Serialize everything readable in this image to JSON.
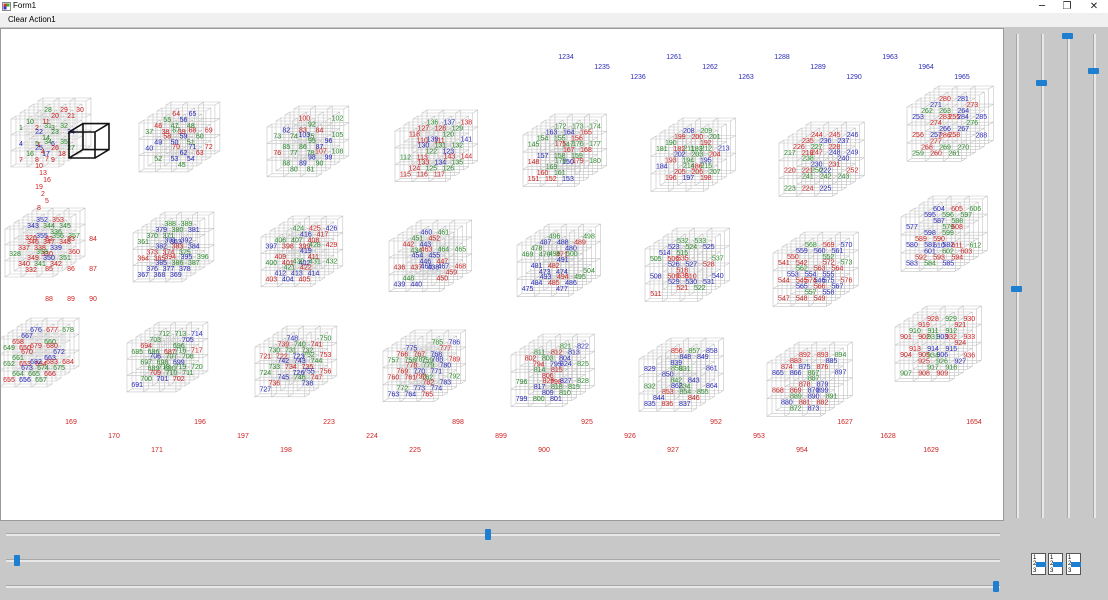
{
  "window": {
    "title": "Form1",
    "minimize": "─",
    "maximize": "❐",
    "close": "✕"
  },
  "menu": [
    "Clear",
    "Action1"
  ],
  "viewport": {
    "label_colors": [
      "#cc2222",
      "#2e8b2e",
      "#2a2ab8"
    ],
    "line_color": "#c4c4c4",
    "highlight_color": "#111111",
    "labels_left": [
      "1",
      "4",
      "7",
      "10",
      "13",
      "16",
      "19",
      "2",
      "5",
      "8"
    ],
    "labels_row2": [
      "82",
      "83",
      "84",
      "85",
      "86",
      "87",
      "88",
      "89",
      "90"
    ],
    "labels_bottom": [
      "169",
      "170",
      "171",
      "196",
      "197",
      "198",
      "223",
      "224",
      "225",
      "898",
      "899",
      "900",
      "925",
      "926",
      "927",
      "952",
      "953",
      "954",
      "1627",
      "1628",
      "1629",
      "1654"
    ],
    "labels_top": [
      "1234",
      "1235",
      "1236",
      "1261",
      "1262",
      "1263",
      "1288",
      "1289",
      "1290",
      "1963",
      "1964",
      "1965"
    ]
  },
  "sliders": {
    "right_vertical": [
      0.51,
      0.11,
      0.01,
      0.08
    ],
    "bottom_horizontal": [
      0.49,
      0.01,
      0.99
    ]
  },
  "mini_panels": [
    [
      "1",
      "2",
      "3"
    ],
    [
      "1",
      "2",
      "3"
    ],
    [
      "1",
      "2",
      "3"
    ]
  ]
}
